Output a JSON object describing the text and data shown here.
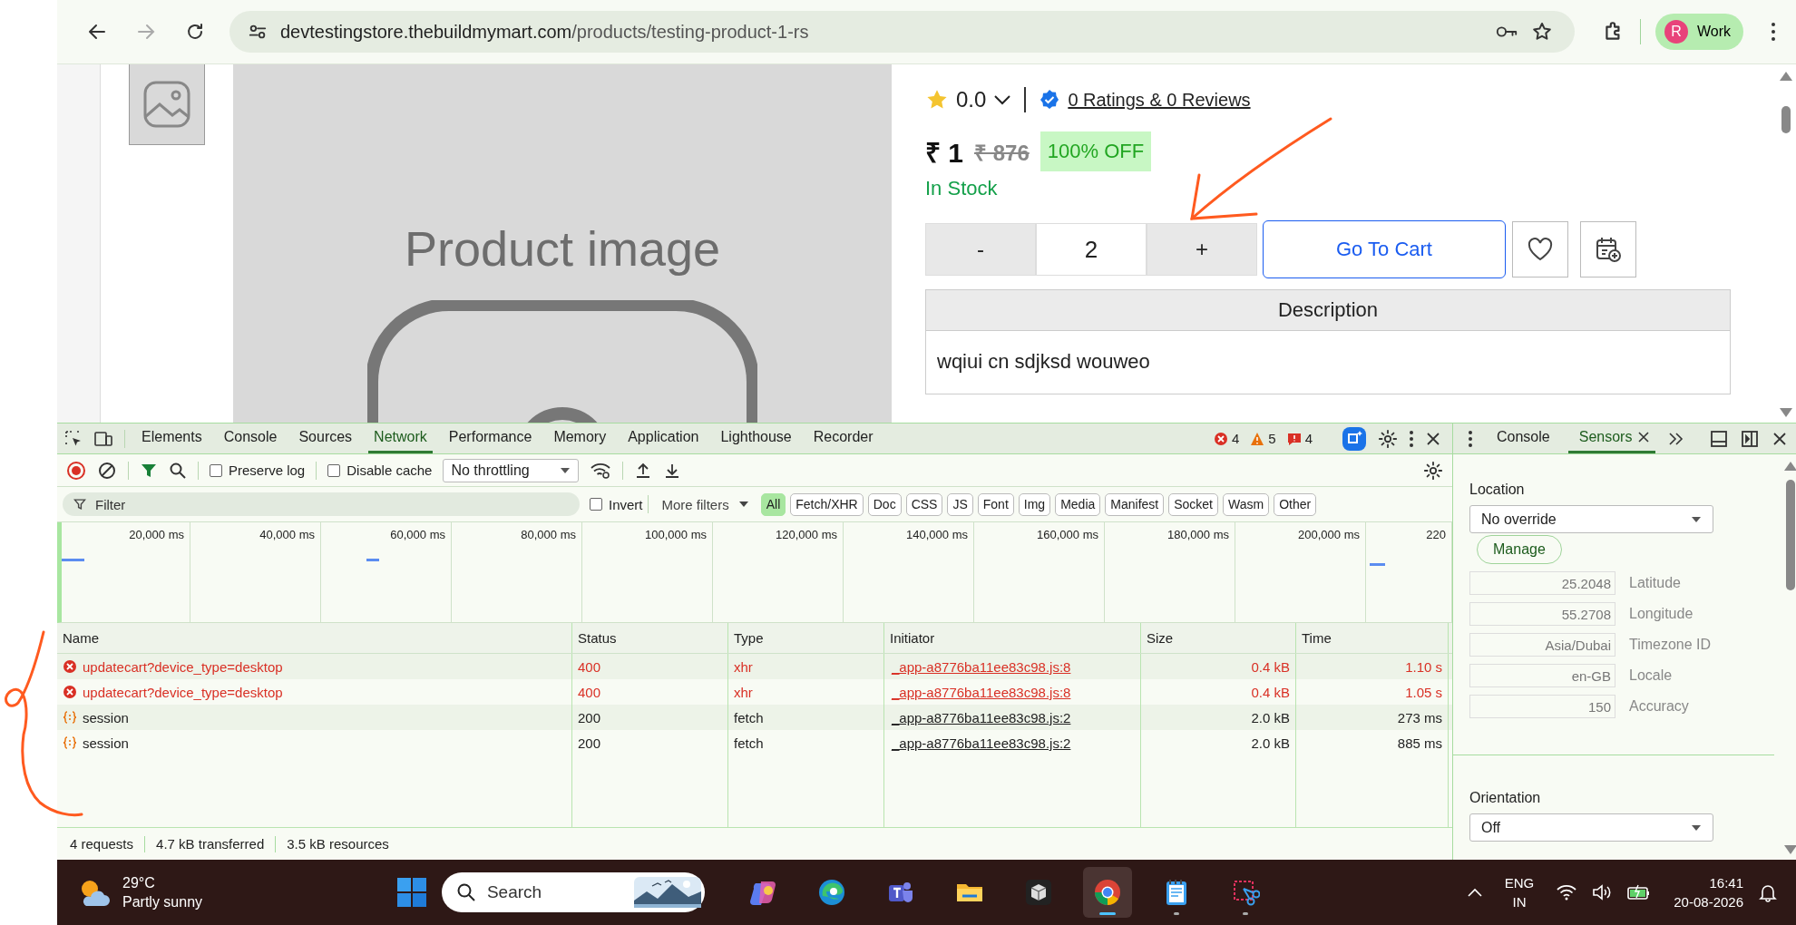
{
  "browser": {
    "url_host": "devtestingstore.thebuildmymart.com",
    "url_path": "/products/testing-product-1-rs",
    "profile_initial": "R",
    "profile_label": "Work"
  },
  "product": {
    "image_label": "Product image",
    "rating": "0.0",
    "reviews_link": "0 Ratings & 0 Reviews",
    "price": "₹ 1",
    "mrp": "₹ 876",
    "discount": "100% OFF",
    "stock": "In Stock",
    "minus": "-",
    "quantity": "2",
    "plus": "+",
    "cart_button": "Go To Cart",
    "description_heading": "Description",
    "description": "wqiui cn sdjksd wouweo"
  },
  "devtools": {
    "tabs": [
      {
        "label": "Elements",
        "selected": false
      },
      {
        "label": "Console",
        "selected": false
      },
      {
        "label": "Sources",
        "selected": false
      },
      {
        "label": "Network",
        "selected": true
      },
      {
        "label": "Performance",
        "selected": false
      },
      {
        "label": "Memory",
        "selected": false
      },
      {
        "label": "Application",
        "selected": false
      },
      {
        "label": "Lighthouse",
        "selected": false
      },
      {
        "label": "Recorder",
        "selected": false
      }
    ],
    "errors": "4",
    "warnings": "5",
    "issues": "4"
  },
  "network": {
    "preserve_log": {
      "label": "Preserve log",
      "checked": false
    },
    "disable_cache": {
      "label": "Disable cache",
      "checked": false
    },
    "throttling": "No throttling",
    "filter_placeholder": "Filter",
    "invert": {
      "label": "Invert",
      "checked": false
    },
    "more_filters": "More filters",
    "type_filters": [
      {
        "label": "All",
        "selected": true
      },
      {
        "label": "Fetch/XHR",
        "selected": false
      },
      {
        "label": "Doc",
        "selected": false
      },
      {
        "label": "CSS",
        "selected": false
      },
      {
        "label": "JS",
        "selected": false
      },
      {
        "label": "Font",
        "selected": false
      },
      {
        "label": "Img",
        "selected": false
      },
      {
        "label": "Media",
        "selected": false
      },
      {
        "label": "Manifest",
        "selected": false
      },
      {
        "label": "Socket",
        "selected": false
      },
      {
        "label": "Wasm",
        "selected": false
      },
      {
        "label": "Other",
        "selected": false
      }
    ],
    "timeline_ticks": [
      "20,000 ms",
      "40,000 ms",
      "60,000 ms",
      "80,000 ms",
      "100,000 ms",
      "120,000 ms",
      "140,000 ms",
      "160,000 ms",
      "180,000 ms",
      "200,000 ms",
      "220"
    ],
    "columns": [
      "Name",
      "Status",
      "Type",
      "Initiator",
      "Size",
      "Time"
    ],
    "rows": [
      {
        "name": "updatecart?device_type=desktop",
        "status": "400",
        "type": "xhr",
        "initiator": "_app-a8776ba11ee83c98.js:8",
        "size": "0.4 kB",
        "time": "1.10 s",
        "failed": true
      },
      {
        "name": "updatecart?device_type=desktop",
        "status": "400",
        "type": "xhr",
        "initiator": "_app-a8776ba11ee83c98.js:8",
        "size": "0.4 kB",
        "time": "1.05 s",
        "failed": true
      },
      {
        "name": "session",
        "status": "200",
        "type": "fetch",
        "initiator": "_app-a8776ba11ee83c98.js:2",
        "size": "2.0 kB",
        "time": "273 ms",
        "failed": false
      },
      {
        "name": "session",
        "status": "200",
        "type": "fetch",
        "initiator": "_app-a8776ba11ee83c98.js:2",
        "size": "2.0 kB",
        "time": "885 ms",
        "failed": false
      }
    ],
    "summary": [
      "4 requests",
      "4.7 kB transferred",
      "3.5 kB resources"
    ]
  },
  "drawer": {
    "tabs": [
      {
        "label": "Console",
        "selected": false,
        "closable": false
      },
      {
        "label": "Sensors",
        "selected": true,
        "closable": true
      }
    ]
  },
  "sensors": {
    "location_label": "Location",
    "location_select": "No override",
    "manage_button": "Manage",
    "fields": [
      {
        "value": "25.2048",
        "label": "Latitude"
      },
      {
        "value": "55.2708",
        "label": "Longitude"
      },
      {
        "value": "Asia/Dubai",
        "label": "Timezone ID"
      },
      {
        "value": "en-GB",
        "label": "Locale"
      },
      {
        "value": "150",
        "label": "Accuracy"
      }
    ],
    "orientation_label": "Orientation",
    "orientation_select": "Off"
  },
  "taskbar": {
    "temperature": "29°C",
    "weather": "Partly sunny",
    "search_placeholder": "Search",
    "apps": [
      {
        "kind": "copilot",
        "running": false,
        "active": false
      },
      {
        "kind": "edge",
        "running": false,
        "active": false
      },
      {
        "kind": "teams",
        "running": false,
        "active": false
      },
      {
        "kind": "files",
        "running": false,
        "active": false
      },
      {
        "kind": "cube",
        "running": false,
        "active": false
      },
      {
        "kind": "chrome",
        "running": true,
        "active": true
      },
      {
        "kind": "notepad",
        "running": true,
        "active": false
      },
      {
        "kind": "snip",
        "running": true,
        "active": false
      }
    ],
    "language": "ENG",
    "region": "IN",
    "time": "16:41",
    "date": "20-08-2026"
  }
}
